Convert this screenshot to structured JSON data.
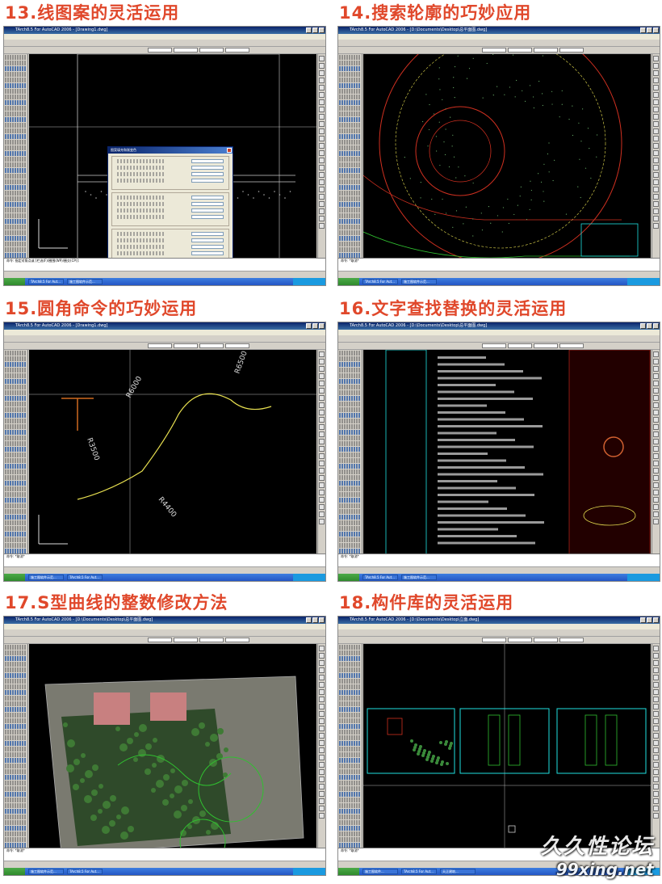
{
  "panels": [
    {
      "title": "13.线图案的灵活运用",
      "window_title": "TArch8.5 For AutoCAD 2006 - [Drawing1.dwg]",
      "theme": "lines",
      "dialog_title": "图案填充和渐变色",
      "command_text": "命令: 指定对角点或 [栏选(F)/圈围(WP)/圈交(CP)]:",
      "taskbar_items": [
        "TArch8.5 For Aut...",
        "施工图软件示范..."
      ]
    },
    {
      "title": "14.搜索轮廓的巧妙应用",
      "window_title": "TArch8.5 For AutoCAD 2006 - [D:\\Documents\\Desktop\\总平面图.dwg]",
      "theme": "circle",
      "command_text": "命令: *取消*",
      "taskbar_items": [
        "TArch8.5 For Aut...",
        "施工图软件示范..."
      ]
    },
    {
      "title": "15.圆角命令的巧妙运用",
      "window_title": "TArch8.5 For AutoCAD 2006 - [Drawing1.dwg]",
      "theme": "scurve",
      "labels": [
        "R6000",
        "R6500",
        "R3500",
        "R4400"
      ],
      "command_text": "命令: *取消*",
      "taskbar_items": [
        "施工图软件示范...",
        "TArch8.5 For Aut..."
      ]
    },
    {
      "title": "16.文字查找替换的灵活运用",
      "window_title": "TArch8.5 For AutoCAD 2006 - [D:\\Documents\\Desktop\\总平面图.dwg]",
      "theme": "text",
      "command_text": "命令: *取消*",
      "taskbar_items": [
        "TArch8.5 For Aut...",
        "施工图软件示范..."
      ]
    },
    {
      "title": "17.S型曲线的整数修改方法",
      "window_title": "TArch8.5 For AutoCAD 2006 - [D:\\Documents\\Desktop\\总平面图.dwg]",
      "theme": "site",
      "command_text": "命令: *取消*",
      "taskbar_items": [
        "施工图软件示范...",
        "TArch8.5 For Aut..."
      ]
    },
    {
      "title": "18.构件库的灵活运用",
      "window_title": "TArch8.5 For AutoCAD 2006 - [D:\\Documents\\Desktop\\立面.dwg]",
      "theme": "elevation",
      "command_text": "命令: *取消*",
      "taskbar_items": [
        "施工图软件...",
        "TArch8.5 For Aut...",
        "天正建筑..."
      ]
    }
  ],
  "watermark": {
    "line1": "久久性论坛",
    "line2": "99xing.net"
  },
  "colors": {
    "title_red": "#e0482b",
    "cad_background": "#000000",
    "cad_yellow": "#e8e050",
    "cad_cyan": "#20e0e0",
    "cad_red": "#d03020",
    "cad_green": "#30c030"
  }
}
